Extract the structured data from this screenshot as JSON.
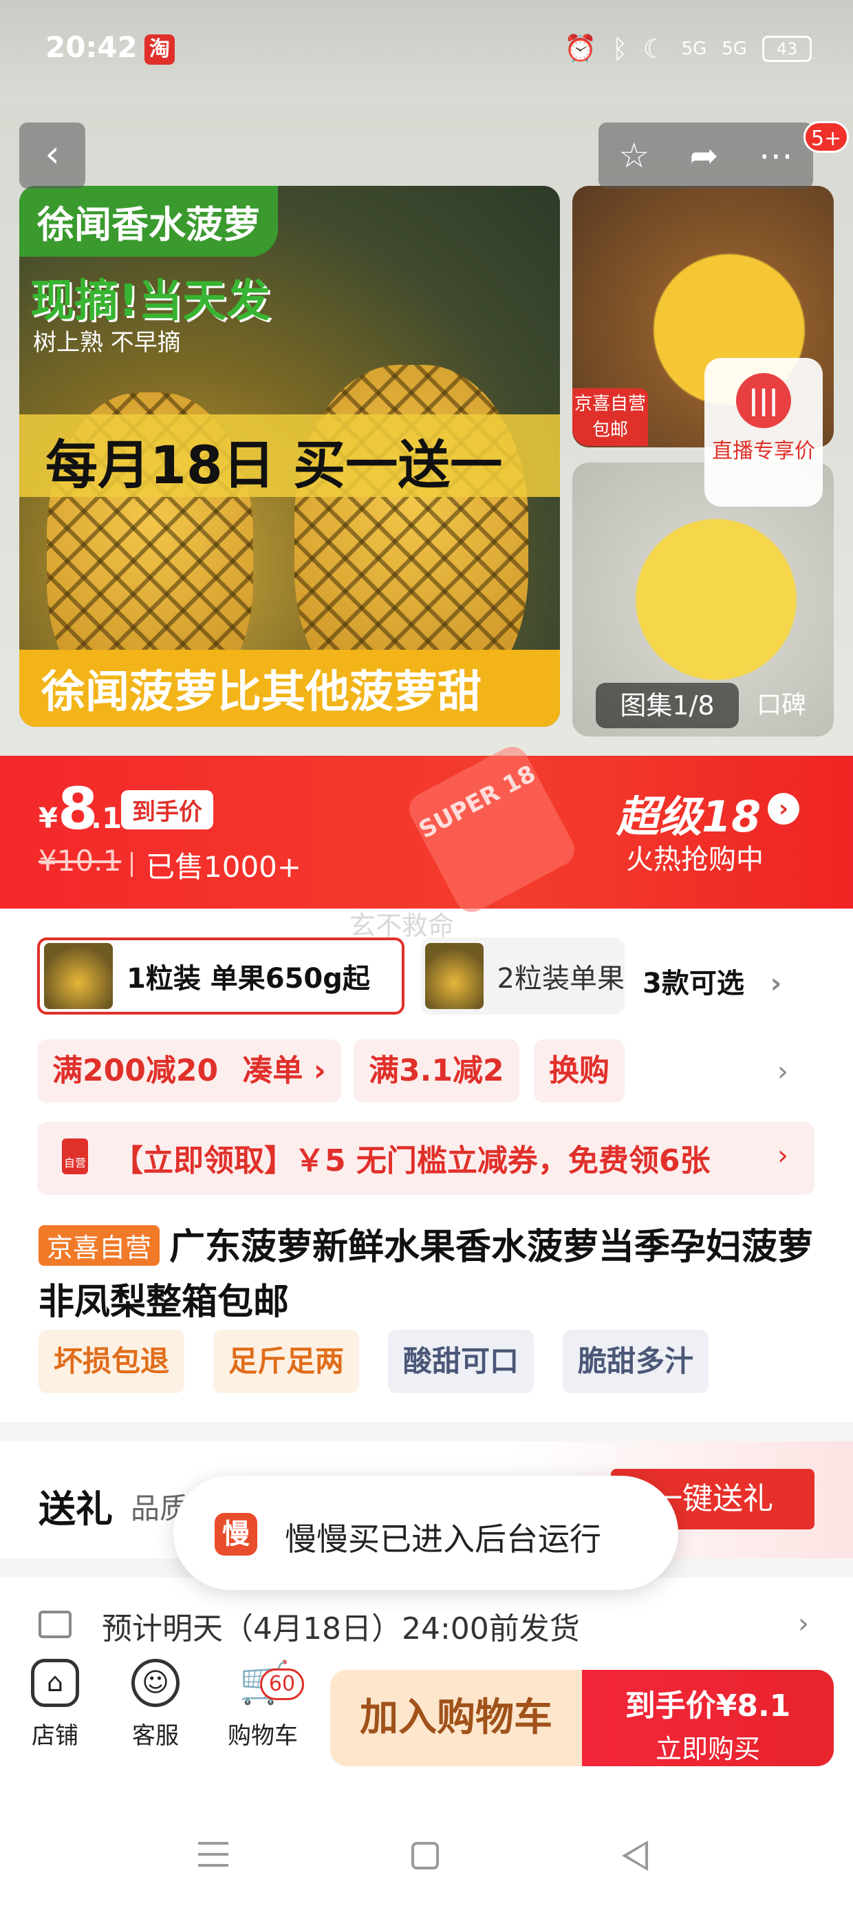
{
  "status_bar": {
    "time": "20:42",
    "app_badge": "淘",
    "network": "5G",
    "battery": "43"
  },
  "gallery": {
    "main_tag": "徐闻香水菠萝",
    "headline": "现摘!当天发",
    "subline": "树上熟 不早摘",
    "promo_band": "每月18日 买一送一",
    "bottom_band": "徐闻菠萝比其他菠萝甜",
    "thumb_badge": "京喜自营 包邮",
    "live_label": "直播专享价",
    "album": "图集1/8",
    "review": "口碑",
    "message_count": "5+"
  },
  "price": {
    "currency": "¥",
    "integer": "8",
    "decimal": ".1",
    "tag": "到手价",
    "original": "¥10.1",
    "sold": "已售1000+",
    "campaign_logo": "SUPER 18",
    "campaign_title": "超级18",
    "campaign_sub": "火热抢购中"
  },
  "watermark": "玄不救命",
  "sku": {
    "option1": "1粒装 单果650g起",
    "option2": "2粒装单果",
    "more": "3款可选"
  },
  "promos": {
    "chip1": "满200减20",
    "chip1_action": "凑单",
    "chip2": "满3.1减2",
    "chip3": "换购",
    "coupon_icon": "自营",
    "coupon": "【立即领取】￥5 无门槛立减券，免费领6张"
  },
  "product": {
    "store_tag": "京喜自营",
    "title": "广东菠萝新鲜水果香水菠萝当季孕妇菠萝非凤梨整箱包邮",
    "features": [
      "坏损包退",
      "足斤足两",
      "酸甜可口",
      "脆甜多汁"
    ]
  },
  "gift": {
    "title": "送礼",
    "subtitle": "品质",
    "button": "一键送礼"
  },
  "toast": {
    "icon": "慢",
    "text": "慢慢买已进入后台运行"
  },
  "delivery": {
    "text": "预计明天（4月18日）24:00前发货"
  },
  "bottom_bar": {
    "store": "店铺",
    "service": "客服",
    "cart": "购物车",
    "cart_count": "60",
    "add_to_cart": "加入购物车",
    "buy_price": "到手价¥8.1",
    "buy_now": "立即购买"
  },
  "colors": {
    "brand_red": "#e0302a",
    "price_bar": "#f4282a",
    "orange": "#f07a28"
  }
}
